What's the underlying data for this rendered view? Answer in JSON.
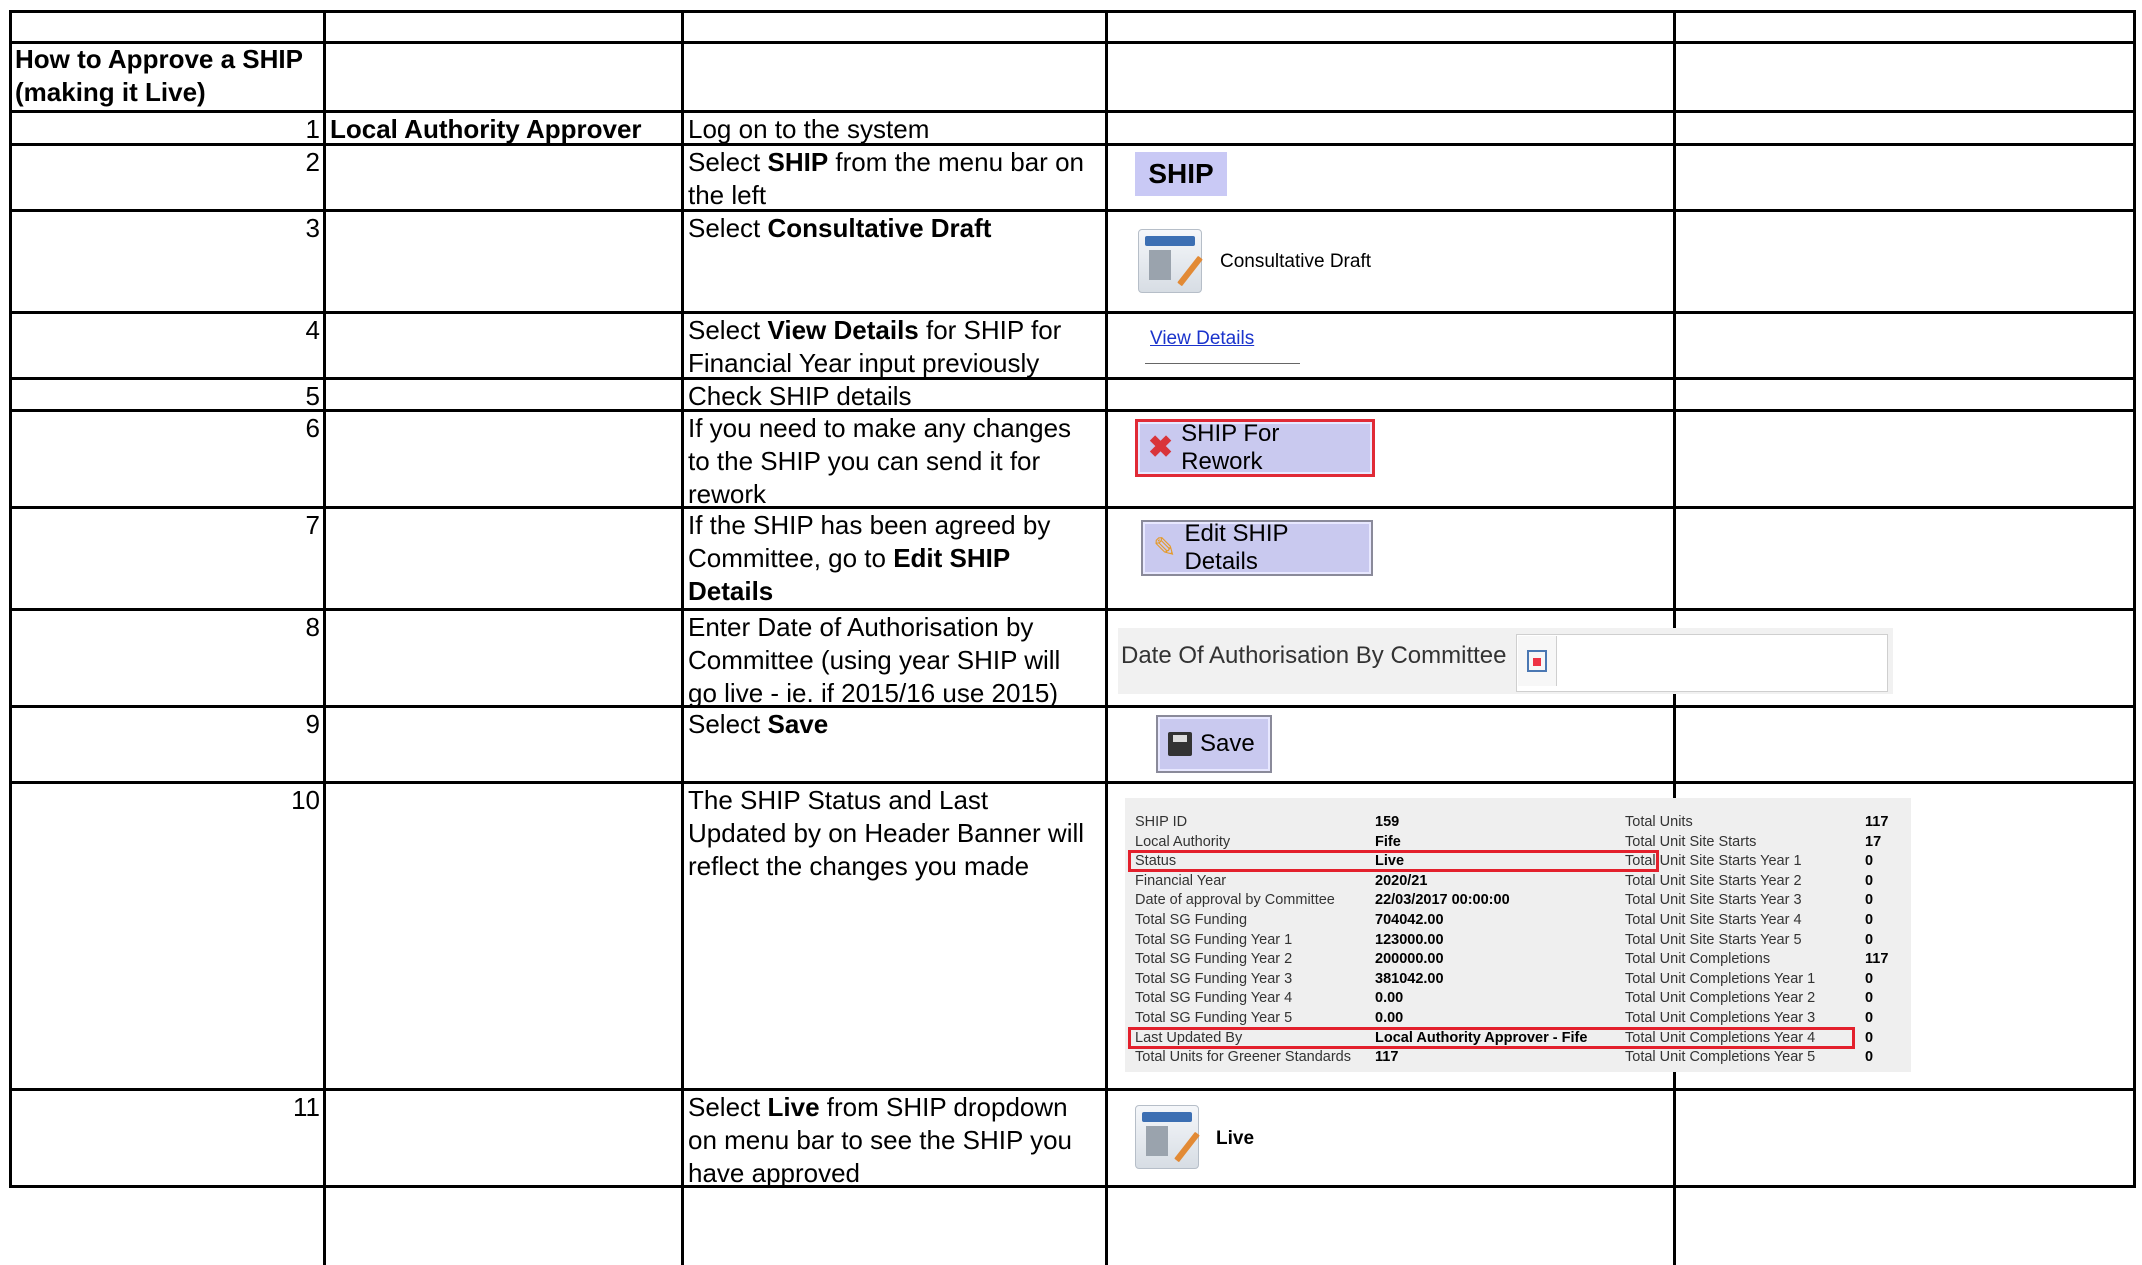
{
  "title_line1": "How to Approve a SHIP",
  "title_line2": "(making it Live)",
  "rows": [
    {
      "num": "1",
      "role": "Local Authority Approver",
      "lines": [
        [
          "Log on to the system"
        ]
      ]
    },
    {
      "num": "2",
      "lines": [
        [
          "Select ",
          {
            "b": "SHIP"
          },
          " from the menu bar on"
        ],
        [
          "the left"
        ]
      ]
    },
    {
      "num": "3",
      "lines": [
        [
          "Select ",
          {
            "b": "Consultative Draft"
          }
        ]
      ]
    },
    {
      "num": "4",
      "lines": [
        [
          "Select ",
          {
            "b": "View Details"
          },
          " for SHIP for"
        ],
        [
          "Financial Year input previously"
        ]
      ]
    },
    {
      "num": "5",
      "lines": [
        [
          "Check SHIP details"
        ]
      ]
    },
    {
      "num": "6",
      "lines": [
        [
          "If you need to make any changes"
        ],
        [
          "to the SHIP you can send it for"
        ],
        [
          "rework"
        ]
      ]
    },
    {
      "num": "7",
      "lines": [
        [
          "If the SHIP has been agreed by"
        ],
        [
          "Committee, go to ",
          {
            "b": "Edit SHIP"
          }
        ],
        [
          {
            "b": "Details"
          }
        ]
      ]
    },
    {
      "num": "8",
      "lines": [
        [
          "Enter Date of Authorisation by"
        ],
        [
          "Committee (using year SHIP will"
        ],
        [
          "go live - ie. if 2015/16 use 2015)"
        ]
      ]
    },
    {
      "num": "9",
      "lines": [
        [
          "Select ",
          {
            "b": "Save"
          }
        ]
      ]
    },
    {
      "num": "10",
      "lines": [
        [
          "The SHIP Status and Last"
        ],
        [
          "Updated by on Header Banner will"
        ],
        [
          "reflect the changes you made"
        ]
      ]
    },
    {
      "num": "11",
      "lines": [
        [
          "Select ",
          {
            "b": "Live"
          },
          " from SHIP dropdown"
        ],
        [
          "on menu bar to see the SHIP you"
        ],
        [
          "have approved"
        ]
      ]
    }
  ],
  "images": {
    "ship_menu": "SHIP",
    "consultative_draft": "Consultative Draft",
    "view_details": "View Details",
    "ship_for_rework": "SHIP For Rework",
    "edit_ship_details": "Edit SHIP Details",
    "date_label": "Date Of Authorisation By Committee",
    "save": "Save",
    "live": "Live"
  },
  "icons": {
    "consultative_draft": "edit-document-icon",
    "rework": "red-x-icon",
    "edit": "pencil-icon",
    "calendar": "calendar-icon",
    "save": "floppy-disk-icon",
    "live": "edit-document-icon"
  },
  "colors": {
    "highlight_red": "#e3202c",
    "button_bg": "#c9c9ef",
    "link_blue": "#1a33cc"
  },
  "banner": {
    "left": [
      [
        "SHIP ID",
        "159"
      ],
      [
        "Local Authority",
        "Fife"
      ],
      [
        "Status",
        "Live"
      ],
      [
        "Financial Year",
        "2020/21"
      ],
      [
        "Date of approval by Committee",
        "22/03/2017 00:00:00"
      ],
      [
        "Total SG Funding",
        "704042.00"
      ],
      [
        "Total SG Funding Year 1",
        "123000.00"
      ],
      [
        "Total SG Funding Year 2",
        "200000.00"
      ],
      [
        "Total SG Funding Year 3",
        "381042.00"
      ],
      [
        "Total SG Funding Year 4",
        "0.00"
      ],
      [
        "Total SG Funding Year 5",
        "0.00"
      ],
      [
        "Last Updated By",
        "Local Authority Approver - Fife"
      ],
      [
        "Total Units for Greener Standards",
        "117"
      ]
    ],
    "right": [
      [
        "Total Units",
        "117"
      ],
      [
        "Total Unit Site Starts",
        "17"
      ],
      [
        "Total Unit Site Starts Year 1",
        "0"
      ],
      [
        "Total Unit Site Starts Year 2",
        "0"
      ],
      [
        "Total Unit Site Starts Year 3",
        "0"
      ],
      [
        "Total Unit Site Starts Year 4",
        "0"
      ],
      [
        "Total Unit Site Starts Year 5",
        "0"
      ],
      [
        "Total Unit Completions",
        "117"
      ],
      [
        "Total Unit Completions Year 1",
        "0"
      ],
      [
        "Total Unit Completions Year 2",
        "0"
      ],
      [
        "Total Unit Completions Year 3",
        "0"
      ],
      [
        "Total Unit Completions Year 4",
        "0"
      ],
      [
        "Total Unit Completions Year 5",
        "0"
      ]
    ]
  }
}
